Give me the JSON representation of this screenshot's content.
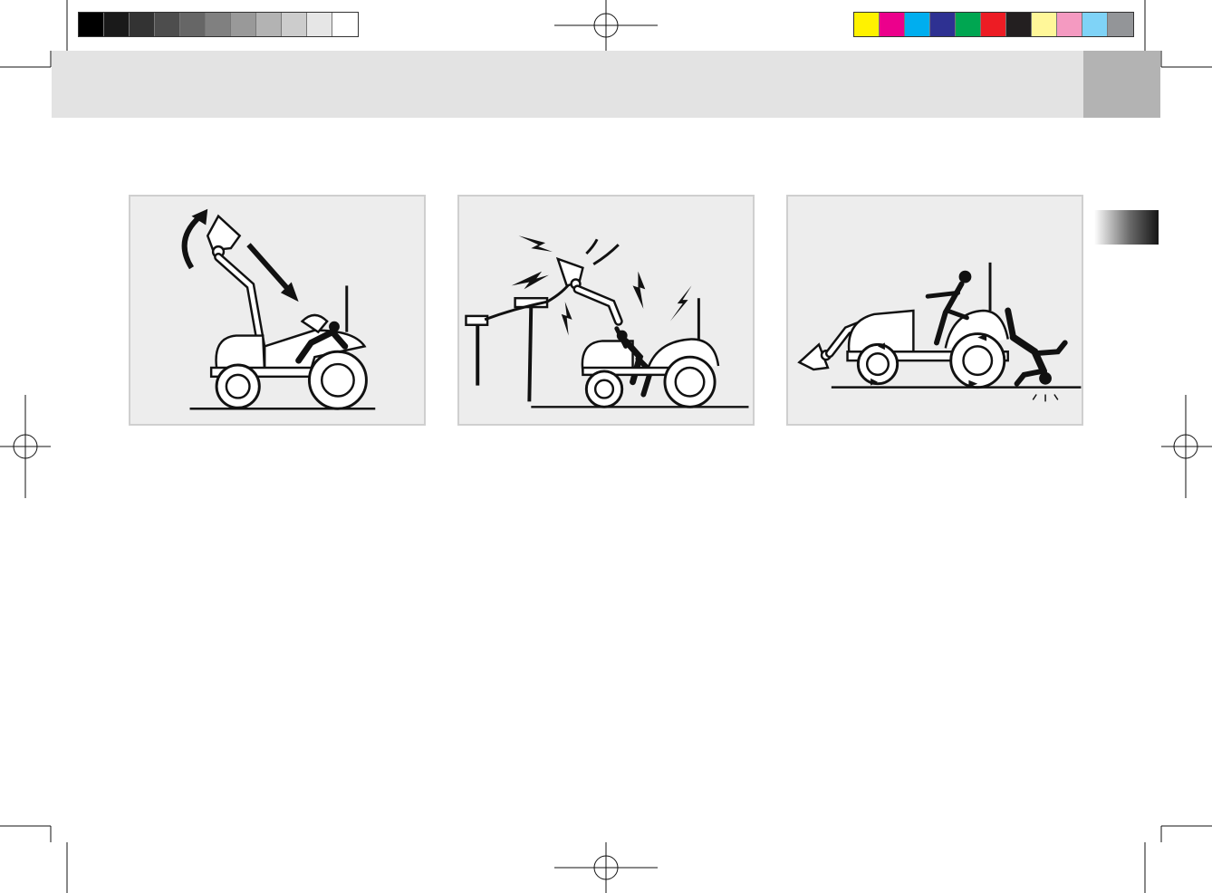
{
  "color_bar": {
    "grayscale": [
      "#000000",
      "#1a1a1a",
      "#333333",
      "#4d4d4d",
      "#666666",
      "#808080",
      "#999999",
      "#b3b3b3",
      "#cccccc",
      "#e6e6e6",
      "#ffffff"
    ],
    "process": [
      "#fff200",
      "#ec008c",
      "#00aeef",
      "#2e3192",
      "#00a651",
      "#ed1c24",
      "#231f20",
      "#fff799",
      "#f49ac1",
      "#7fd3f7",
      "#939598"
    ]
  },
  "colors": {
    "header_band": "#e3e3e3",
    "header_tab": "#b3b3b3",
    "panel_background": "#ededed",
    "panel_border": "#cfcfcf",
    "ink": "#111111"
  },
  "illustrations": [
    {
      "id": "bucket-falling-on-operator"
    },
    {
      "id": "loader-contacting-power-lines"
    },
    {
      "id": "bystander-run-over-by-tractor"
    }
  ]
}
